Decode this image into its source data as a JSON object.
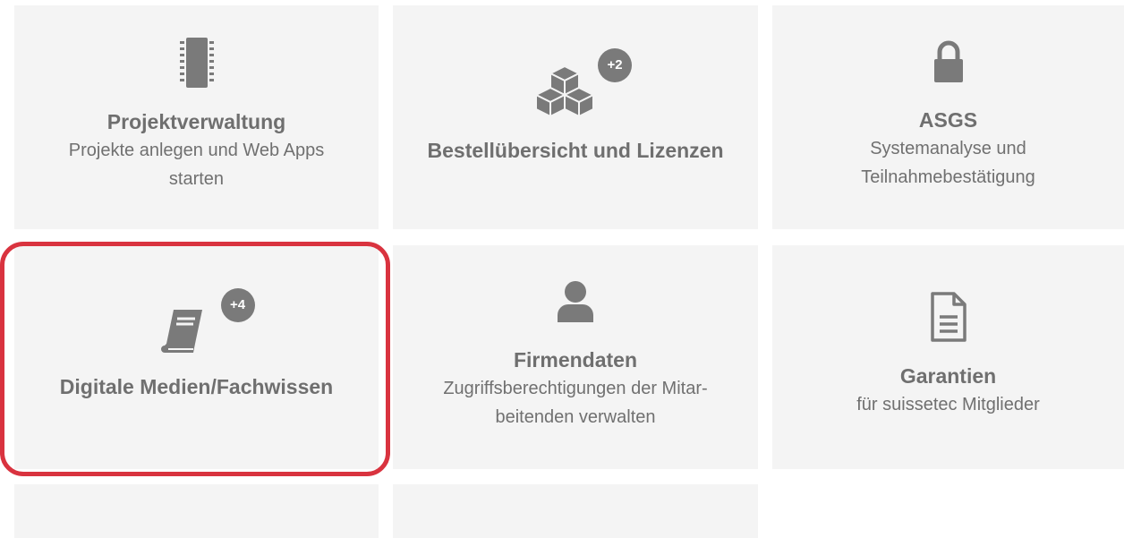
{
  "tiles": {
    "projekt": {
      "title": "Projektverwaltung",
      "subtitle": "Projekte anlegen und Web Apps\nstarten",
      "icon": "chip-icon"
    },
    "bestell": {
      "title": "Bestellübersicht und Lizenzen",
      "badge": "+2",
      "icon": "cubes-icon"
    },
    "asgs": {
      "title": "ASGS",
      "subtitle": "Systemanalyse und\nTeilnahmebestätigung",
      "icon": "lock-icon"
    },
    "medien": {
      "title": "Digitale Medien/Fachwissen",
      "badge": "+4",
      "icon": "book-icon"
    },
    "firma": {
      "title": "Firmendaten",
      "subtitle": "Zugriffsberechtigungen der Mitar-\nbeitenden verwalten",
      "icon": "user-icon"
    },
    "garantien": {
      "title": "Garantien",
      "subtitle": "für suissetec Mitglieder",
      "icon": "document-icon"
    }
  },
  "colors": {
    "tile_bg": "#f4f4f4",
    "icon": "#7a7a7a",
    "highlight": "#d9333f"
  }
}
